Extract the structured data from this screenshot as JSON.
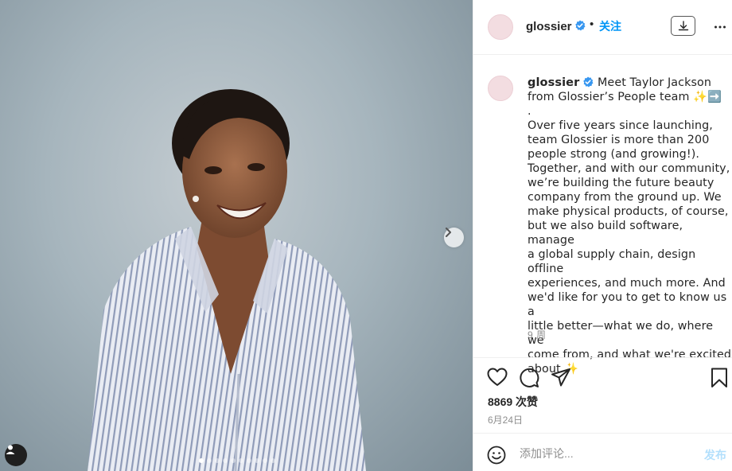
{
  "post": {
    "photo": {
      "description_icon": "photo",
      "carousel_total": 10,
      "carousel_active_index": 0
    },
    "header": {
      "username": "glossier",
      "separator": "•",
      "follow_label": "关注"
    },
    "caption": {
      "username": "glossier",
      "lines": [
        "Meet Taylor Jackson",
        "from Glossier’s People team ✨➡️",
        ".",
        "Over five years since launching,",
        "team Glossier is more than 200",
        "people strong (and growing!).",
        "Together, and with our community,",
        "we’re building the future beauty",
        "company from the ground up. We",
        "make physical products, of course,",
        "but we also build software, manage",
        "a global supply chain, design offline",
        "experiences, and much more. And",
        "we'd like for you to get to know us a",
        "little better—what we do, where we",
        "come from, and what we're excited",
        "about ✨"
      ],
      "time_ago": "9 周"
    },
    "actions": {
      "likes": "8869 次赞",
      "date": "6月24日"
    },
    "comment": {
      "placeholder": "添加评论...",
      "post_label": "发布"
    },
    "colors": {
      "accent_blue": "#0095f6",
      "verified_blue": "#3897f0",
      "post_disabled": "#b2dffc",
      "avatar_pink": "#f3dde1"
    }
  }
}
